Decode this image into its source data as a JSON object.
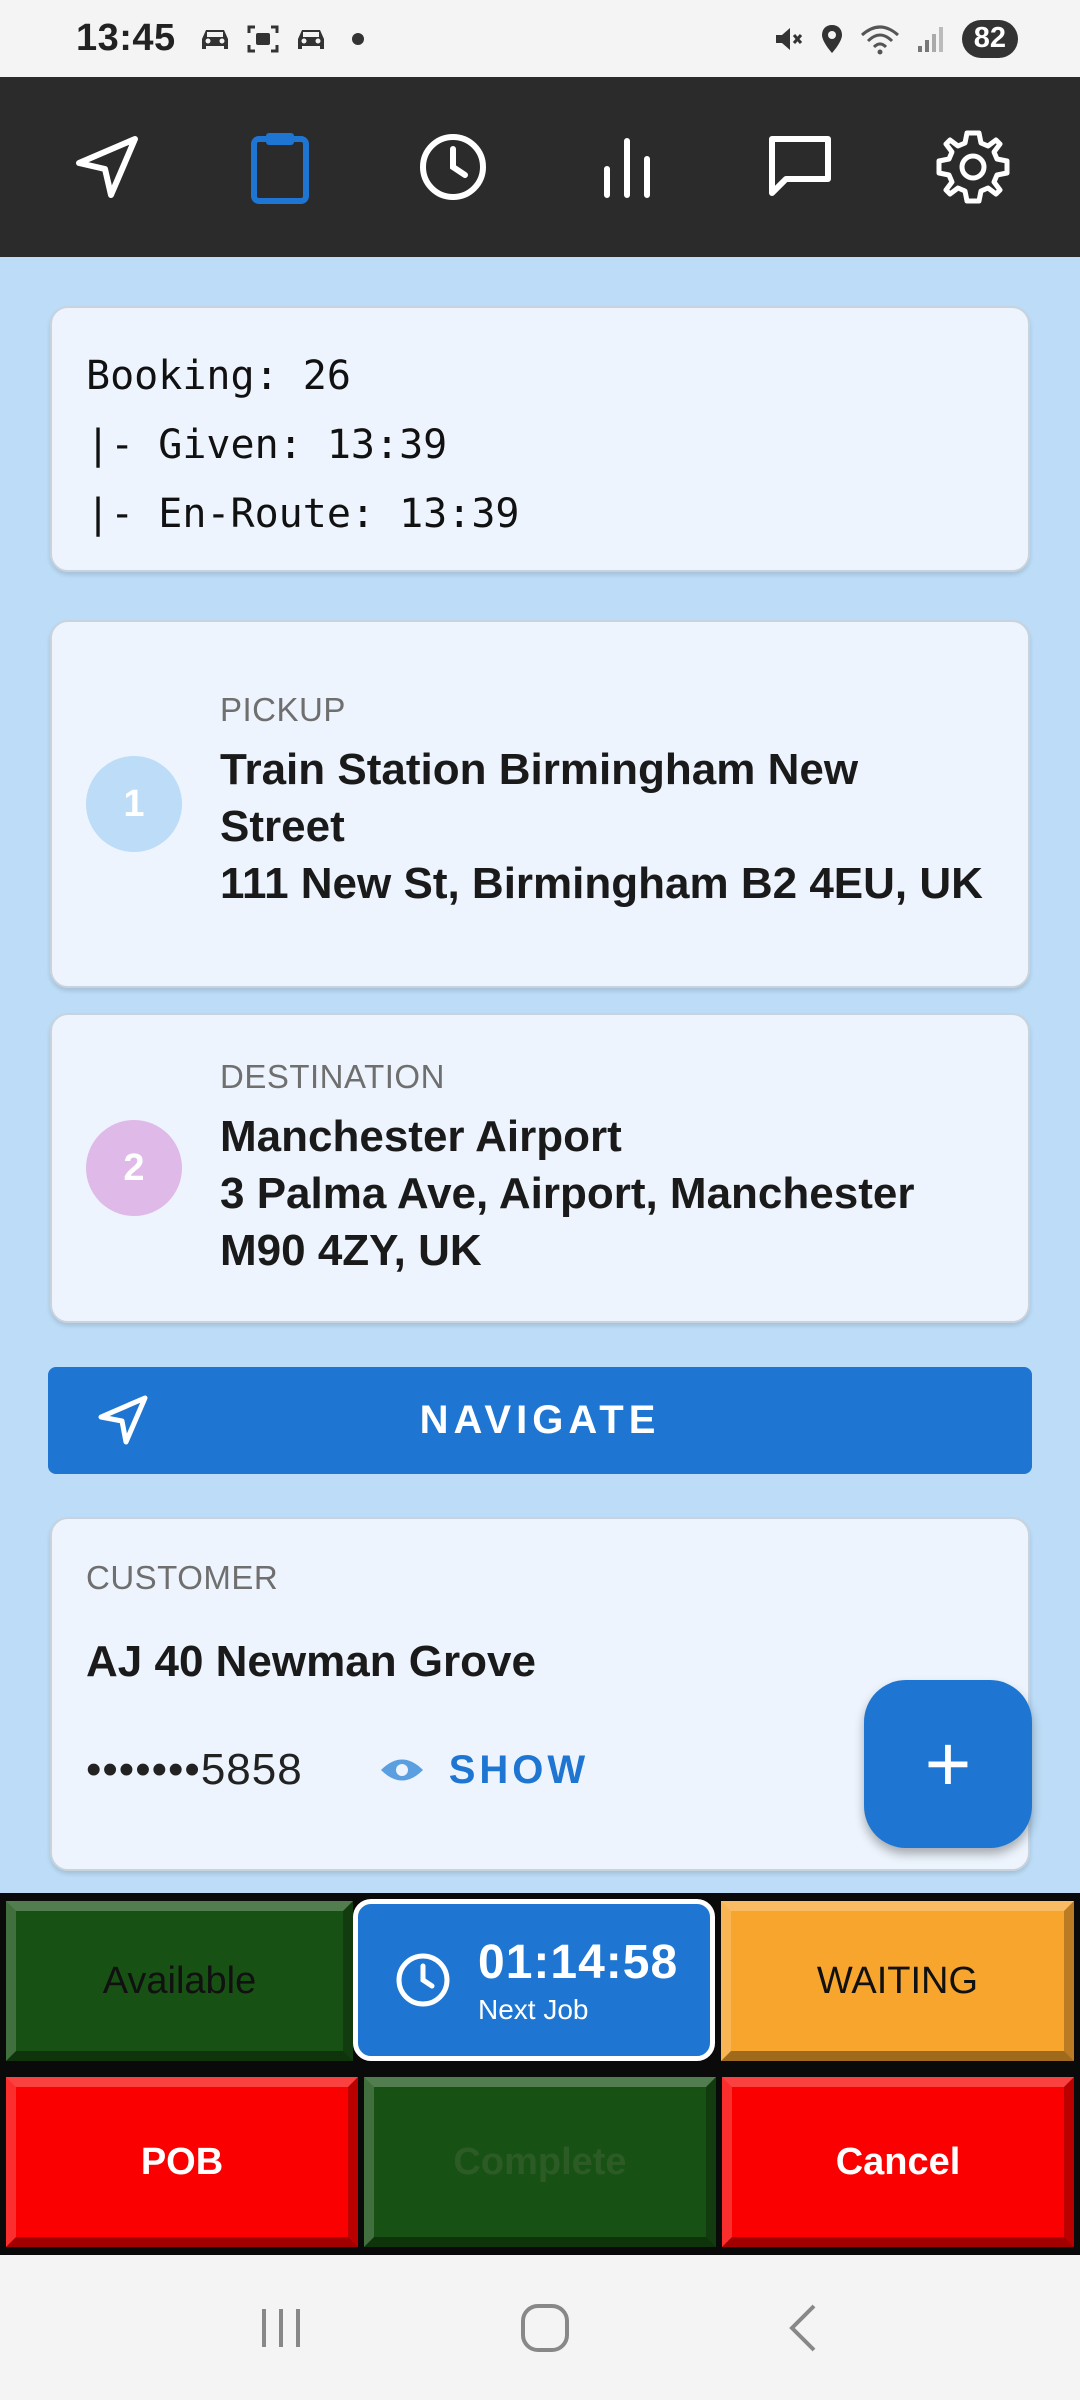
{
  "status_bar": {
    "time": "13:45",
    "battery": "82",
    "icons_left": [
      "car-icon",
      "screen-record-icon",
      "car-icon"
    ],
    "icons_right": [
      "mute-icon",
      "location-icon",
      "wifi-icon",
      "signal-icon"
    ]
  },
  "top_nav": {
    "items": [
      {
        "name": "navigation-icon",
        "active": false
      },
      {
        "name": "clipboard-icon",
        "active": true
      },
      {
        "name": "clock-icon",
        "active": false
      },
      {
        "name": "bar-chart-icon",
        "active": false
      },
      {
        "name": "chat-icon",
        "active": false
      },
      {
        "name": "gear-icon",
        "active": false
      }
    ],
    "active_color": "#1e76d2"
  },
  "booking": {
    "line1": "Booking: 26",
    "line2": "|- Given: 13:39",
    "line3": "|- En-Route: 13:39"
  },
  "pickup": {
    "number": "1",
    "label": "PICKUP",
    "address": "Train Station Birmingham New Street\n111 New St, Birmingham B2 4EU, UK",
    "circle_color": "#bcdcf7"
  },
  "destination": {
    "number": "2",
    "label": "DESTINATION",
    "address": "Manchester Airport\n3 Palma Ave, Airport, Manchester M90 4ZY, UK",
    "circle_color": "#dfb9e8"
  },
  "navigate": {
    "label": "NAVIGATE"
  },
  "customer": {
    "label": "CUSTOMER",
    "name": "AJ 40 Newman Grove",
    "phone_masked": "•••••••5858",
    "show_label": "SHOW"
  },
  "fab": {
    "label": "+"
  },
  "actions": {
    "available": "Available",
    "timer": "01:14:58",
    "timer_sub": "Next Job",
    "waiting": "WAITING",
    "pob": "POB",
    "complete": "Complete",
    "cancel": "Cancel"
  },
  "colors": {
    "accent": "#1e76d2",
    "background": "#bcdcf7",
    "available_green": "#185114",
    "waiting_orange": "#f8a52e",
    "alert_red": "#fa0000"
  }
}
